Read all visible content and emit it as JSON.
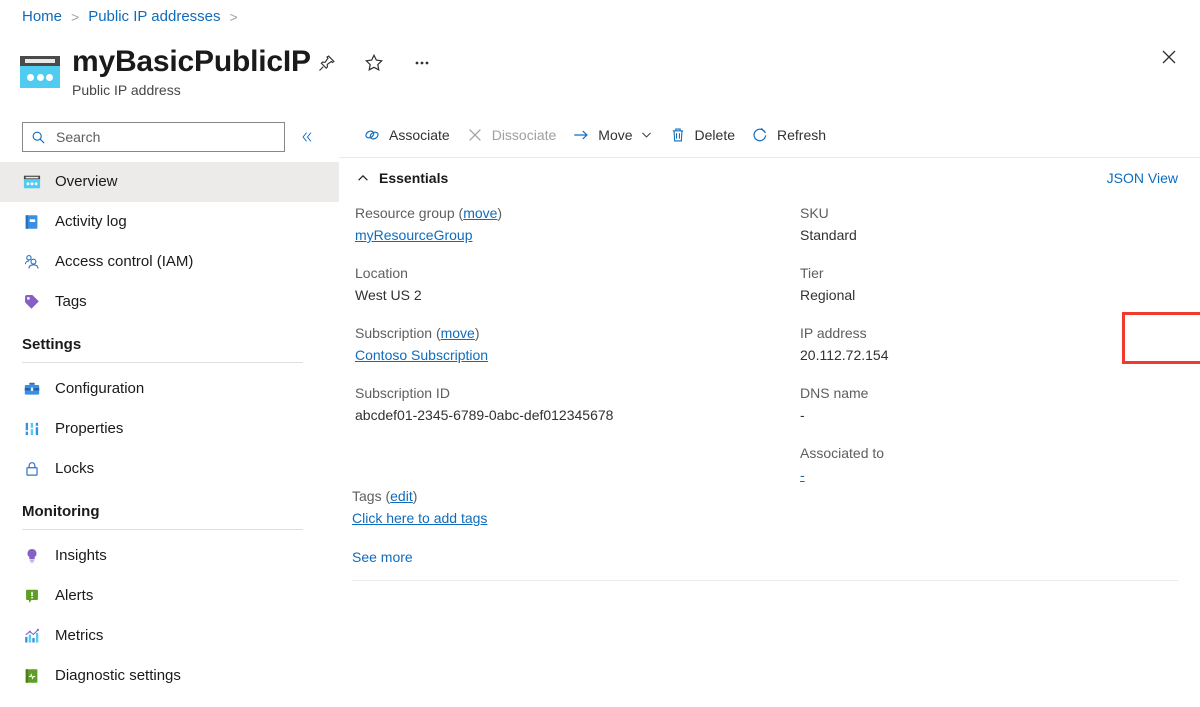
{
  "breadcrumb": {
    "items": [
      {
        "label": "Home"
      },
      {
        "label": "Public IP addresses"
      }
    ],
    "separator": ">"
  },
  "header": {
    "title": "myBasicPublicIP",
    "subtitle": "Public IP address",
    "resource_icon": "public-ip-address-icon",
    "actions": [
      {
        "name": "pin-icon",
        "label": "Pin"
      },
      {
        "name": "favorite-star-icon",
        "label": "Favorite"
      },
      {
        "name": "more-ellipsis-icon",
        "label": "More"
      }
    ],
    "close_label": "Close"
  },
  "sidebar": {
    "search": {
      "placeholder": "Search",
      "value": "",
      "icon": "search-icon"
    },
    "collapse": {
      "icon": "chevron-double-left-icon",
      "label": "«"
    },
    "items": [
      {
        "label": "Overview",
        "icon": "overview-icon",
        "selected": true
      },
      {
        "label": "Activity log",
        "icon": "activity-log-icon",
        "selected": false
      },
      {
        "label": "Access control (IAM)",
        "icon": "access-control-icon",
        "selected": false
      },
      {
        "label": "Tags",
        "icon": "tags-icon",
        "selected": false
      }
    ],
    "groups": [
      {
        "title": "Settings",
        "items": [
          {
            "label": "Configuration",
            "icon": "configuration-icon"
          },
          {
            "label": "Properties",
            "icon": "properties-icon"
          },
          {
            "label": "Locks",
            "icon": "locks-icon"
          }
        ]
      },
      {
        "title": "Monitoring",
        "items": [
          {
            "label": "Insights",
            "icon": "insights-icon"
          },
          {
            "label": "Alerts",
            "icon": "alerts-icon"
          },
          {
            "label": "Metrics",
            "icon": "metrics-icon"
          },
          {
            "label": "Diagnostic settings",
            "icon": "diagnostic-settings-icon"
          }
        ]
      }
    ]
  },
  "toolbar": {
    "associate_label": "Associate",
    "dissociate_label": "Dissociate",
    "move_label": "Move",
    "delete_label": "Delete",
    "refresh_label": "Refresh"
  },
  "essentials": {
    "section_label": "Essentials",
    "json_view_label": "JSON View",
    "left": [
      {
        "key": "Resource group",
        "key_link": "move",
        "value": "myResourceGroup",
        "value_is_link": true
      },
      {
        "key": "Location",
        "key_link": "",
        "value": "West US 2",
        "value_is_link": false
      },
      {
        "key": "Subscription",
        "key_link": "move",
        "value": "Contoso Subscription",
        "value_is_link": true
      },
      {
        "key": "Subscription ID",
        "key_link": "",
        "value": "abcdef01-2345-6789-0abc-def012345678",
        "value_is_link": false
      }
    ],
    "right": [
      {
        "key": "SKU",
        "value": "Standard",
        "value_is_link": false,
        "highlighted": true
      },
      {
        "key": "Tier",
        "value": "Regional",
        "value_is_link": false,
        "highlighted": false
      },
      {
        "key": "IP address",
        "value": "20.112.72.154",
        "value_is_link": false,
        "highlighted": false
      },
      {
        "key": "DNS name",
        "value": "-",
        "value_is_link": false,
        "highlighted": false
      },
      {
        "key": "Associated to",
        "value": "-",
        "value_is_link": true,
        "highlighted": false
      }
    ],
    "tags": {
      "key": "Tags",
      "key_link": "edit",
      "value": "Click here to add tags"
    },
    "see_more_label": "See more"
  },
  "colors": {
    "link": "#0f6cbd",
    "highlight_box": "#f03a2e",
    "selected_nav_bg": "#edebe9",
    "accent_cyan": "#50ccf0"
  }
}
